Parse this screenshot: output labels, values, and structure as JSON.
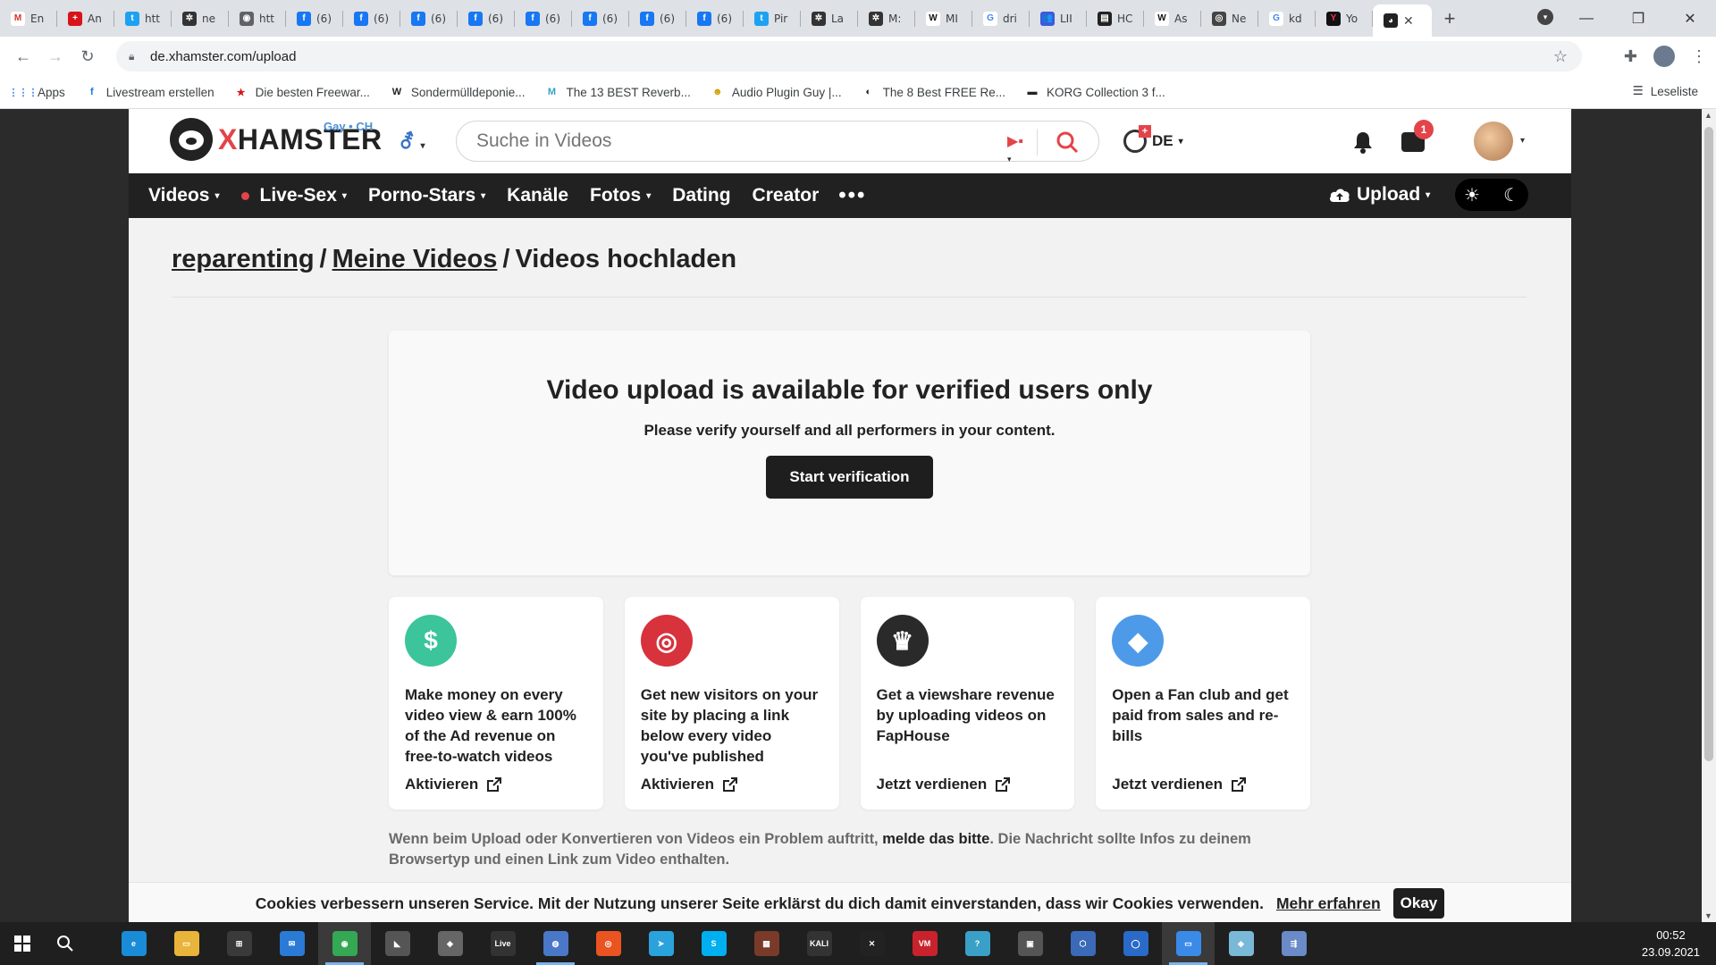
{
  "browser": {
    "tabs": [
      {
        "title": "En",
        "fav_color": "#ffffff",
        "fav_glyph": "M",
        "fav_fg": "#d93025"
      },
      {
        "title": "An",
        "fav_color": "#d7141a",
        "fav_glyph": "+",
        "fav_fg": "#ffffff"
      },
      {
        "title": "htt",
        "fav_color": "#1da1f2",
        "fav_glyph": "t",
        "fav_fg": "#ffffff"
      },
      {
        "title": "ne",
        "fav_color": "#333333",
        "fav_glyph": "✲",
        "fav_fg": "#ffffff"
      },
      {
        "title": "htt",
        "fav_color": "#5f6368",
        "fav_glyph": "◉",
        "fav_fg": "#ffffff"
      },
      {
        "title": "(6)",
        "fav_color": "#1877f2",
        "fav_glyph": "f",
        "fav_fg": "#ffffff"
      },
      {
        "title": "(6)",
        "fav_color": "#1877f2",
        "fav_glyph": "f",
        "fav_fg": "#ffffff"
      },
      {
        "title": "(6)",
        "fav_color": "#1877f2",
        "fav_glyph": "f",
        "fav_fg": "#ffffff"
      },
      {
        "title": "(6)",
        "fav_color": "#1877f2",
        "fav_glyph": "f",
        "fav_fg": "#ffffff"
      },
      {
        "title": "(6)",
        "fav_color": "#1877f2",
        "fav_glyph": "f",
        "fav_fg": "#ffffff"
      },
      {
        "title": "(6)",
        "fav_color": "#1877f2",
        "fav_glyph": "f",
        "fav_fg": "#ffffff"
      },
      {
        "title": "(6)",
        "fav_color": "#1877f2",
        "fav_glyph": "f",
        "fav_fg": "#ffffff"
      },
      {
        "title": "(6)",
        "fav_color": "#1877f2",
        "fav_glyph": "f",
        "fav_fg": "#ffffff"
      },
      {
        "title": "Pir",
        "fav_color": "#1da1f2",
        "fav_glyph": "t",
        "fav_fg": "#ffffff"
      },
      {
        "title": "La",
        "fav_color": "#333333",
        "fav_glyph": "✲",
        "fav_fg": "#ffffff"
      },
      {
        "title": "M:",
        "fav_color": "#333333",
        "fav_glyph": "✲",
        "fav_fg": "#ffffff"
      },
      {
        "title": "MI",
        "fav_color": "#ffffff",
        "fav_glyph": "W",
        "fav_fg": "#111111"
      },
      {
        "title": "dri",
        "fav_color": "#ffffff",
        "fav_glyph": "G",
        "fav_fg": "#4285f4"
      },
      {
        "title": "LII",
        "fav_color": "#3b5bdb",
        "fav_glyph": "👥",
        "fav_fg": "#ffffff"
      },
      {
        "title": "HC",
        "fav_color": "#222222",
        "fav_glyph": "▤",
        "fav_fg": "#ffffff"
      },
      {
        "title": "As",
        "fav_color": "#ffffff",
        "fav_glyph": "W",
        "fav_fg": "#111111"
      },
      {
        "title": "Ne",
        "fav_color": "#444444",
        "fav_glyph": "◎",
        "fav_fg": "#ffffff"
      },
      {
        "title": "kd",
        "fav_color": "#ffffff",
        "fav_glyph": "G",
        "fav_fg": "#4285f4"
      },
      {
        "title": "Yo",
        "fav_color": "#111111",
        "fav_glyph": "Y",
        "fav_fg": "#ff2d55"
      }
    ],
    "active_tab_close": "✕",
    "new_tab": "+",
    "url": "de.xhamster.com/upload",
    "bookmarks": [
      {
        "label": "Apps",
        "glyph": "⋮⋮⋮",
        "color": "#4285f4"
      },
      {
        "label": "Livestream erstellen",
        "glyph": "f",
        "color": "#1877f2"
      },
      {
        "label": "Die besten Freewar...",
        "glyph": "★",
        "color": "#d7141a"
      },
      {
        "label": "Sondermülldeponie...",
        "glyph": "W",
        "color": "#222222"
      },
      {
        "label": "The 13 BEST Reverb...",
        "glyph": "M",
        "color": "#3aa0c8"
      },
      {
        "label": "Audio Plugin Guy |...",
        "glyph": "☻",
        "color": "#d4a000"
      },
      {
        "label": "The 8 Best FREE Re...",
        "glyph": "◐",
        "color": "#222222"
      },
      {
        "label": "KORG Collection 3 f...",
        "glyph": "▬",
        "color": "#222222"
      }
    ],
    "reading_list": "Leseliste"
  },
  "site": {
    "logo_x": "X",
    "logo_rest": "HAMSTER",
    "logo_tag": "Gay • CH",
    "search_placeholder": "Suche in Videos",
    "lang": "DE",
    "mail_badge": "1",
    "nav": [
      {
        "label": "Videos",
        "caret": true,
        "live_dot": false
      },
      {
        "label": "Live-Sex",
        "caret": true,
        "live_dot": true
      },
      {
        "label": "Porno-Stars",
        "caret": true,
        "live_dot": false
      },
      {
        "label": "Kanäle",
        "caret": false,
        "live_dot": false
      },
      {
        "label": "Fotos",
        "caret": true,
        "live_dot": false
      },
      {
        "label": "Dating",
        "caret": false,
        "live_dot": false
      },
      {
        "label": "Creator",
        "caret": false,
        "live_dot": false
      }
    ],
    "nav_more": "•••",
    "upload_label": "Upload",
    "accent": "#e34449"
  },
  "page": {
    "breadcrumb": {
      "user": "reparenting",
      "sep": "/",
      "my_videos": "Meine Videos",
      "current": "Videos hochladen"
    },
    "verify": {
      "title": "Video upload is available for verified users only",
      "subtitle": "Please verify yourself and all performers in your content.",
      "button": "Start verification"
    },
    "cards": [
      {
        "icon": "dollar-icon",
        "glyph": "$",
        "color": "#3cc49a",
        "text": "Make money on every video view & earn 100% of the Ad revenue on free-to-watch videos",
        "action": "Aktivieren"
      },
      {
        "icon": "target-icon",
        "glyph": "◎",
        "color": "#d8323c",
        "text": "Get new visitors on your site by placing a link below every video you've published",
        "action": "Aktivieren"
      },
      {
        "icon": "crown-icon",
        "glyph": "♛",
        "color": "#2a2a2a",
        "text": "Get a viewshare revenue by uploading videos on FapHouse",
        "action": "Jetzt verdienen"
      },
      {
        "icon": "diamond-icon",
        "glyph": "◆",
        "color": "#4d9be8",
        "text": "Open a Fan club and get paid from sales and re-bills",
        "action": "Jetzt verdienen"
      }
    ],
    "note": {
      "before": "Wenn beim Upload oder Konvertieren von Videos ein Problem auftritt, ",
      "link": "melde das bitte",
      "after": ". Die Nachricht sollte Infos zu deinem Browsertyp und einen Link zum Video enthalten."
    },
    "cookie": {
      "text": "Cookies verbessern unseren Service. Mit der Nutzung unserer Seite erklärst du dich damit einverstanden, dass wir Cookies verwenden.",
      "more": "Mehr erfahren",
      "ok": "Okay"
    }
  },
  "taskbar": {
    "apps": [
      {
        "name": "taskbar-edge",
        "glyph": "e",
        "color": "#1a8bd6",
        "state": ""
      },
      {
        "name": "taskbar-explorer",
        "glyph": "▭",
        "color": "#e8b53a",
        "state": ""
      },
      {
        "name": "taskbar-store",
        "glyph": "⊞",
        "color": "#3a3a3a",
        "state": ""
      },
      {
        "name": "taskbar-mail",
        "glyph": "✉",
        "color": "#2a7ad6",
        "state": ""
      },
      {
        "name": "taskbar-chrome",
        "glyph": "◉",
        "color": "#34a853",
        "state": "active"
      },
      {
        "name": "taskbar-app-6",
        "glyph": "◣",
        "color": "#555555",
        "state": ""
      },
      {
        "name": "taskbar-app-7",
        "glyph": "◆",
        "color": "#666666",
        "state": ""
      },
      {
        "name": "taskbar-live",
        "glyph": "Live",
        "color": "#333333",
        "state": ""
      },
      {
        "name": "taskbar-app-9",
        "glyph": "◍",
        "color": "#4a78c8",
        "state": "run"
      },
      {
        "name": "taskbar-ubuntu",
        "glyph": "◎",
        "color": "#e95420",
        "state": ""
      },
      {
        "name": "taskbar-telegram",
        "glyph": "➤",
        "color": "#2aa3dd",
        "state": ""
      },
      {
        "name": "taskbar-skype",
        "glyph": "S",
        "color": "#00aff0",
        "state": ""
      },
      {
        "name": "taskbar-app-13",
        "glyph": "▦",
        "color": "#7a3a2a",
        "state": ""
      },
      {
        "name": "taskbar-kali",
        "glyph": "KALI",
        "color": "#333333",
        "state": ""
      },
      {
        "name": "taskbar-app-15",
        "glyph": "✕",
        "color": "#222222",
        "state": ""
      },
      {
        "name": "taskbar-voicemeeter",
        "glyph": "VM",
        "color": "#c8232c",
        "state": ""
      },
      {
        "name": "taskbar-app-17",
        "glyph": "?",
        "color": "#3aa0c8",
        "state": ""
      },
      {
        "name": "taskbar-app-18",
        "glyph": "▣",
        "color": "#555555",
        "state": ""
      },
      {
        "name": "taskbar-app-19",
        "glyph": "⬡",
        "color": "#3a6ab8",
        "state": ""
      },
      {
        "name": "taskbar-app-20",
        "glyph": "◯",
        "color": "#2a6ac8",
        "state": ""
      },
      {
        "name": "taskbar-app-21",
        "glyph": "▭",
        "color": "#3a8ae8",
        "state": "active"
      },
      {
        "name": "taskbar-app-22",
        "glyph": "◈",
        "color": "#7ab8d8",
        "state": ""
      },
      {
        "name": "taskbar-app-23",
        "glyph": "⇶",
        "color": "#6a8ac8",
        "state": ""
      }
    ],
    "time": "00:52",
    "date": "23.09.2021"
  }
}
